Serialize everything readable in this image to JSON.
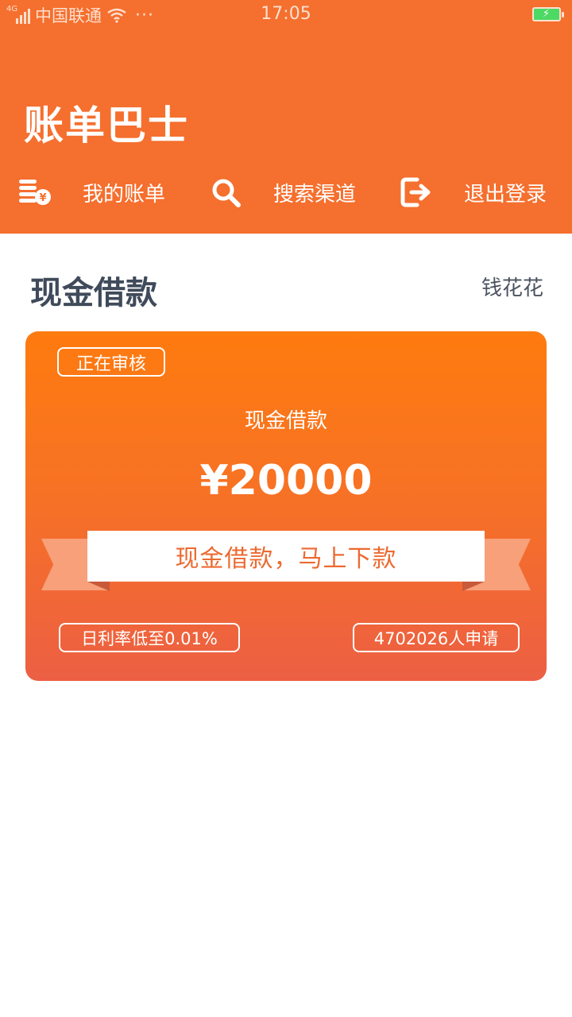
{
  "status_bar": {
    "network": "4G",
    "carrier": "中国联通",
    "more": "···",
    "time": "17:05"
  },
  "app": {
    "title": "账单巴士"
  },
  "nav": {
    "items": [
      {
        "label": "我的账单",
        "icon": "coins-bill-icon"
      },
      {
        "label": "搜索渠道",
        "icon": "search-icon"
      },
      {
        "label": "退出登录",
        "icon": "logout-icon"
      }
    ]
  },
  "section": {
    "title": "现金借款",
    "side_label": "钱花花"
  },
  "card": {
    "status": "正在审核",
    "product_name": "现金借款",
    "amount": "¥20000",
    "ribbon_text": "现金借款，马上下款",
    "rate_text": "日利率低至0.01%",
    "applicants_text": "4702026人申请"
  },
  "colors": {
    "brand": "#f56f2e",
    "card_top": "#fe7b0f",
    "card_bottom": "#ec5f44",
    "ribbon_text": "#ec6a31"
  }
}
